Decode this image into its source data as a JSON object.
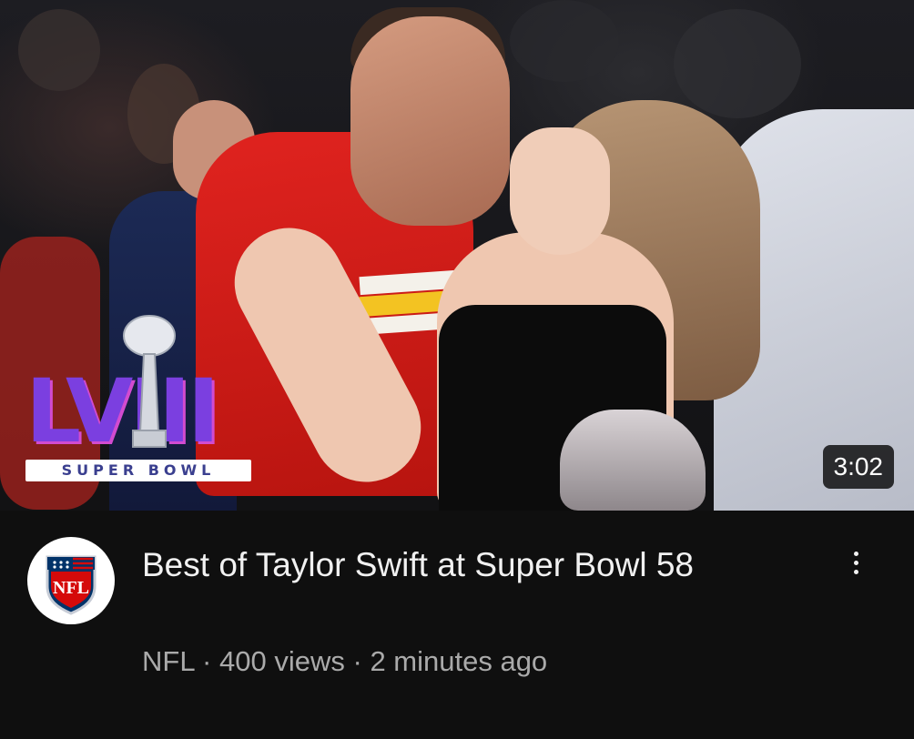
{
  "video": {
    "duration": "3:02",
    "thumbnail_logo_banner": "SUPER BOWL",
    "thumbnail_logo_letters": "LVIII",
    "title": "Best of Taylor Swift at Super Bowl 58",
    "channel": "NFL",
    "separator": "·",
    "views": "400 views",
    "age": "2 minutes ago",
    "avatar_text": "NFL"
  },
  "icons": {
    "menu": "more-vert-icon",
    "channel_avatar": "nfl-shield-icon",
    "trophy": "trophy-icon"
  },
  "colors": {
    "background": "#0f0f0f",
    "title": "#f1f1f1",
    "meta": "#aaaaaa",
    "nfl_blue": "#013369",
    "nfl_red": "#d50a0a"
  }
}
